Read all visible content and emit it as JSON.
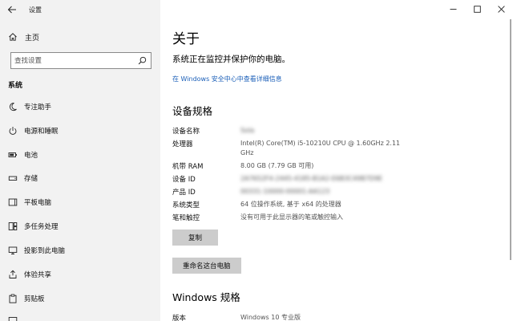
{
  "app": {
    "title": "设置"
  },
  "sidebar": {
    "home_label": "主页",
    "search_placeholder": "查找设置",
    "section": "系统",
    "items": [
      {
        "label": "专注助手",
        "icon": "moon-icon"
      },
      {
        "label": "电源和睡眠",
        "icon": "power-icon"
      },
      {
        "label": "电池",
        "icon": "battery-icon"
      },
      {
        "label": "存储",
        "icon": "storage-icon"
      },
      {
        "label": "平板电脑",
        "icon": "tablet-icon"
      },
      {
        "label": "多任务处理",
        "icon": "multitask-icon"
      },
      {
        "label": "投影到此电脑",
        "icon": "projector-icon"
      },
      {
        "label": "体验共享",
        "icon": "share-icon"
      },
      {
        "label": "剪贴板",
        "icon": "clipboard-icon"
      }
    ]
  },
  "main": {
    "title": "关于",
    "status": "系统正在监控并保护你的电脑。",
    "defender_link": "在 Windows 安全中心中查看详细信息",
    "device_heading": "设备规格",
    "specs": [
      {
        "key": "设备名称",
        "value": "Sola"
      },
      {
        "key": "处理器",
        "value": "Intel(R) Core(TM) i5-10210U CPU @ 1.60GHz   2.11 GHz"
      },
      {
        "key": "机带 RAM",
        "value": "8.00 GB (7.79 GB 可用)"
      },
      {
        "key": "设备 ID",
        "value": "2A7652F4-2445-4185-B1A2-E6B3C49B7D9E"
      },
      {
        "key": "产品 ID",
        "value": "00331-10000-00001-AA123"
      },
      {
        "key": "系统类型",
        "value": "64 位操作系统, 基于 x64 的处理器"
      },
      {
        "key": "笔和触控",
        "value": "没有可用于此显示器的笔或触控输入"
      }
    ],
    "copy_button": "复制",
    "rename_button": "重命名这台电脑",
    "windows_heading": "Windows 规格",
    "edition_key": "版本",
    "edition_value": "Windows 10 专业版"
  }
}
